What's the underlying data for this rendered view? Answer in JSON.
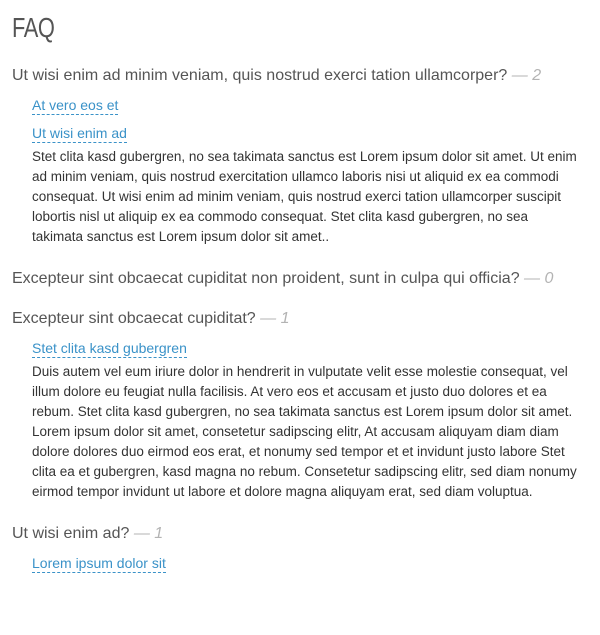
{
  "page": {
    "title": "FAQ"
  },
  "faq": {
    "count_prefix": "— ",
    "items": [
      {
        "question": "Ut wisi enim ad minim veniam, quis nostrud exerci tation ullamcorper?",
        "count": "2",
        "answers": [
          {
            "label": "At vero eos et"
          },
          {
            "label": "Ut wisi enim ad",
            "text": "Stet clita kasd gubergren, no sea takimata sanctus est Lorem ipsum dolor sit amet. Ut enim ad minim veniam, quis nostrud exercitation ullamco laboris nisi ut aliquid ex ea commodi consequat. Ut wisi enim ad minim veniam, quis nostrud exerci tation ullamcorper suscipit lobortis nisl ut aliquip ex ea commodo consequat. Stet clita kasd gubergren, no sea takimata sanctus est Lorem ipsum dolor sit amet.."
          }
        ]
      },
      {
        "question": "Excepteur sint obcaecat cupiditat non proident, sunt in culpa qui officia?",
        "count": "0",
        "answers": []
      },
      {
        "question": "Excepteur sint obcaecat cupiditat?",
        "count": "1",
        "answers": [
          {
            "label": "Stet clita kasd gubergren",
            "text": "Duis autem vel eum iriure dolor in hendrerit in vulputate velit esse molestie consequat, vel illum dolore eu feugiat nulla facilisis. At vero eos et accusam et justo duo dolores et ea rebum. Stet clita kasd gubergren, no sea takimata sanctus est Lorem ipsum dolor sit amet. Lorem ipsum dolor sit amet, consetetur sadipscing elitr, At accusam aliquyam diam diam dolore dolores duo eirmod eos erat, et nonumy sed tempor et et invidunt justo labore Stet clita ea et gubergren, kasd magna no rebum. Consetetur sadipscing elitr, sed diam nonumy eirmod tempor invidunt ut labore et dolore magna aliquyam erat, sed diam voluptua."
          }
        ]
      },
      {
        "question": "Ut wisi enim ad?",
        "count": "1",
        "answers": [
          {
            "label": "Lorem ipsum dolor sit"
          }
        ]
      }
    ]
  }
}
